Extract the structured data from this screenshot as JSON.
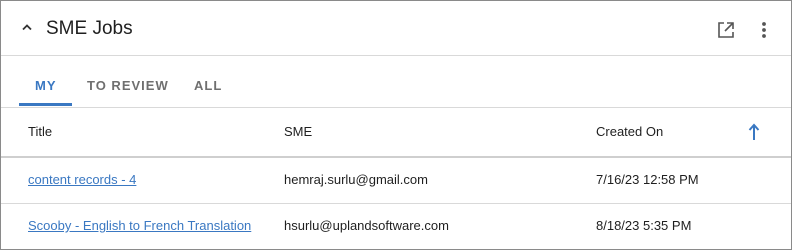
{
  "widget": {
    "title": "SME Jobs",
    "icons": {
      "collapse": "chevron-up-icon",
      "open": "open-in-new-icon",
      "more": "more-vertical-icon",
      "sort": "arrow-up-icon"
    },
    "accent_color": "#3a78c2"
  },
  "tabs": [
    {
      "label": "MY",
      "active": true
    },
    {
      "label": "TO REVIEW",
      "active": false
    },
    {
      "label": "ALL",
      "active": false
    }
  ],
  "table": {
    "columns": [
      "Title",
      "SME",
      "Created On"
    ],
    "sort": {
      "direction": "ascending"
    },
    "rows": [
      {
        "title": "content records - 4",
        "sme": "hemraj.surlu@gmail.com",
        "created_on": "7/16/23 12:58 PM"
      },
      {
        "title": "Scooby - English to French Translation",
        "sme": "hsurlu@uplandsoftware.com",
        "created_on": "8/18/23 5:35 PM"
      }
    ]
  }
}
